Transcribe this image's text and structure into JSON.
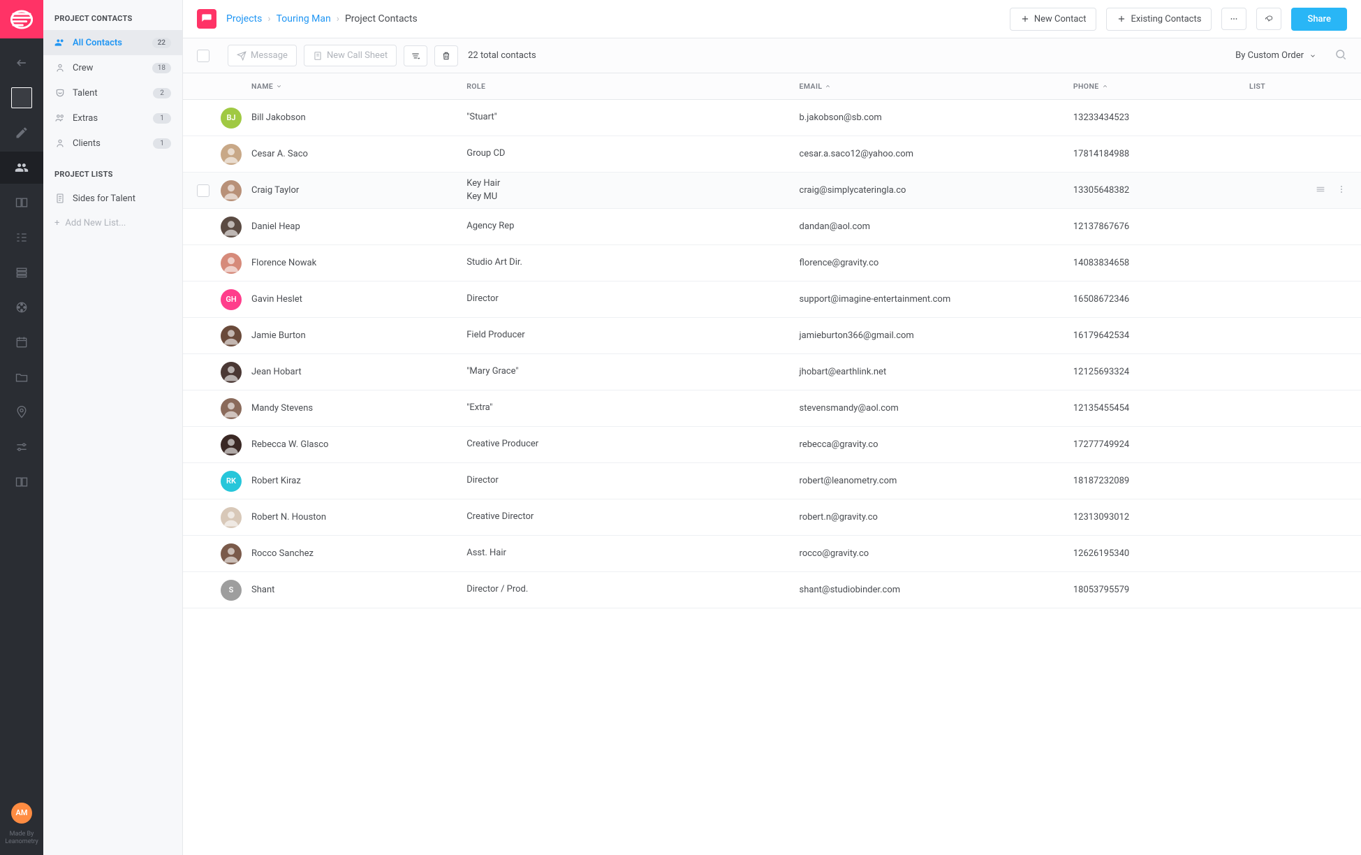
{
  "breadcrumbs": {
    "root": "Projects",
    "project": "Touring Man",
    "page": "Project Contacts"
  },
  "topActions": {
    "newContact": "New Contact",
    "existingContacts": "Existing Contacts",
    "share": "Share"
  },
  "rail": {
    "avatarInitials": "AM",
    "credit1": "Made By",
    "credit2": "Leanometry"
  },
  "sidebar": {
    "section1": "PROJECT CONTACTS",
    "section2": "PROJECT LISTS",
    "contacts": [
      {
        "label": "All Contacts",
        "count": "22",
        "active": true,
        "icon": "users"
      },
      {
        "label": "Crew",
        "count": "18",
        "active": false,
        "icon": "crew"
      },
      {
        "label": "Talent",
        "count": "2",
        "active": false,
        "icon": "mask"
      },
      {
        "label": "Extras",
        "count": "1",
        "active": false,
        "icon": "ppl"
      },
      {
        "label": "Clients",
        "count": "1",
        "active": false,
        "icon": "person"
      }
    ],
    "lists": [
      {
        "label": "Sides for Talent"
      }
    ],
    "addList": "Add New List..."
  },
  "toolbar": {
    "message": "Message",
    "newCallSheet": "New Call Sheet",
    "count": "22 total contacts",
    "sort": "By Custom Order"
  },
  "columns": {
    "name": "NAME",
    "role": "ROLE",
    "email": "EMAIL",
    "phone": "PHONE",
    "list": "LIST"
  },
  "rows": [
    {
      "name": "Bill Jakobson",
      "roles": [
        "\"Stuart\""
      ],
      "email": "b.jakobson@sb.com",
      "phone": "13233434523",
      "avatar": {
        "type": "initials",
        "text": "BJ",
        "color": "#a0c943"
      }
    },
    {
      "name": "Cesar A. Saco",
      "roles": [
        "Group CD"
      ],
      "email": "cesar.a.saco12@yahoo.com",
      "phone": "17814184988",
      "avatar": {
        "type": "photo",
        "color": "#c8a887"
      }
    },
    {
      "name": "Craig Taylor",
      "roles": [
        "Key Hair",
        "Key MU"
      ],
      "email": "craig@simplycateringla.co",
      "phone": "13305648382",
      "avatar": {
        "type": "photo",
        "color": "#b89078"
      },
      "hovered": true
    },
    {
      "name": "Daniel Heap",
      "roles": [
        "Agency Rep"
      ],
      "email": "dandan@aol.com",
      "phone": "12137867676",
      "avatar": {
        "type": "photo",
        "color": "#5a4a42"
      }
    },
    {
      "name": "Florence Nowak",
      "roles": [
        "Studio Art Dir."
      ],
      "email": "florence@gravity.co",
      "phone": "14083834658",
      "avatar": {
        "type": "photo",
        "color": "#d68a7a"
      }
    },
    {
      "name": "Gavin Heslet",
      "roles": [
        "Director"
      ],
      "email": "support@imagine-entertainment.com",
      "phone": "16508672346",
      "avatar": {
        "type": "initials",
        "text": "GH",
        "color": "#ff3d8b"
      }
    },
    {
      "name": "Jamie Burton",
      "roles": [
        "Field Producer"
      ],
      "email": "jamieburton366@gmail.com",
      "phone": "16179642534",
      "avatar": {
        "type": "photo",
        "color": "#6a4a3a"
      }
    },
    {
      "name": "Jean Hobart",
      "roles": [
        "\"Mary Grace\""
      ],
      "email": "jhobart@earthlink.net",
      "phone": "12125693324",
      "avatar": {
        "type": "photo",
        "color": "#4a3834"
      }
    },
    {
      "name": "Mandy Stevens",
      "roles": [
        "\"Extra\""
      ],
      "email": "stevensmandy@aol.com",
      "phone": "12135455454",
      "avatar": {
        "type": "photo",
        "color": "#8a6a5a"
      }
    },
    {
      "name": "Rebecca W. Glasco",
      "roles": [
        "Creative Producer"
      ],
      "email": "rebecca@gravity.co",
      "phone": "17277749924",
      "avatar": {
        "type": "photo",
        "color": "#3a2824"
      }
    },
    {
      "name": "Robert Kiraz",
      "roles": [
        "Director"
      ],
      "email": "robert@leanometry.com",
      "phone": "18187232089",
      "avatar": {
        "type": "initials",
        "text": "RK",
        "color": "#26c6da"
      }
    },
    {
      "name": "Robert N. Houston",
      "roles": [
        "Creative Director"
      ],
      "email": "robert.n@gravity.co",
      "phone": "12313093012",
      "avatar": {
        "type": "photo",
        "color": "#d8c8b8"
      }
    },
    {
      "name": "Rocco Sanchez",
      "roles": [
        "Asst. Hair"
      ],
      "email": "rocco@gravity.co",
      "phone": "12626195340",
      "avatar": {
        "type": "photo",
        "color": "#7a5a4a"
      }
    },
    {
      "name": "Shant",
      "roles": [
        "Director / Prod."
      ],
      "email": "shant@studiobinder.com",
      "phone": "18053795579",
      "avatar": {
        "type": "initials",
        "text": "S",
        "color": "#9e9e9e"
      }
    }
  ]
}
